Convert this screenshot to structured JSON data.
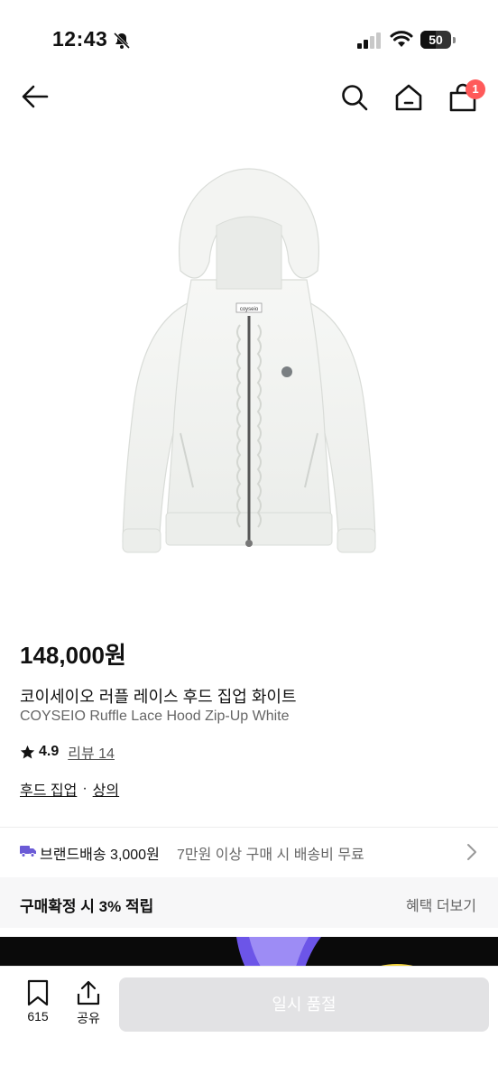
{
  "status_bar": {
    "time": "12:43",
    "battery": "50"
  },
  "nav": {
    "back_icon": "arrow-left-icon",
    "search_icon": "search-icon",
    "home_icon": "home-icon",
    "cart_icon": "shopping-bag-icon",
    "cart_count": "1"
  },
  "product": {
    "price": "148,000원",
    "name_ko": "코이세이오 러플 레이스 후드 집업 화이트",
    "name_en": "COYSEIO Ruffle Lace Hood Zip-Up White",
    "rating": "4.9",
    "review_label": "리뷰 14",
    "category_1": "후드 집업",
    "category_separator": "·",
    "category_2": "상의",
    "hoodie_label": "coyseio"
  },
  "shipping": {
    "label": "브랜드배송 3,000원",
    "note": "7만원 이상 구매 시 배송비 무료"
  },
  "benefit": {
    "label": "구매확정 시 3% 적립",
    "more": "혜택 더보기"
  },
  "bottom_bar": {
    "save_count": "615",
    "share_label": "공유",
    "buy_label": "일시 품절"
  },
  "colors": {
    "badge": "#ff5a5a",
    "truck": "#6b5bd6",
    "buy_button": "#e2e2e4"
  }
}
